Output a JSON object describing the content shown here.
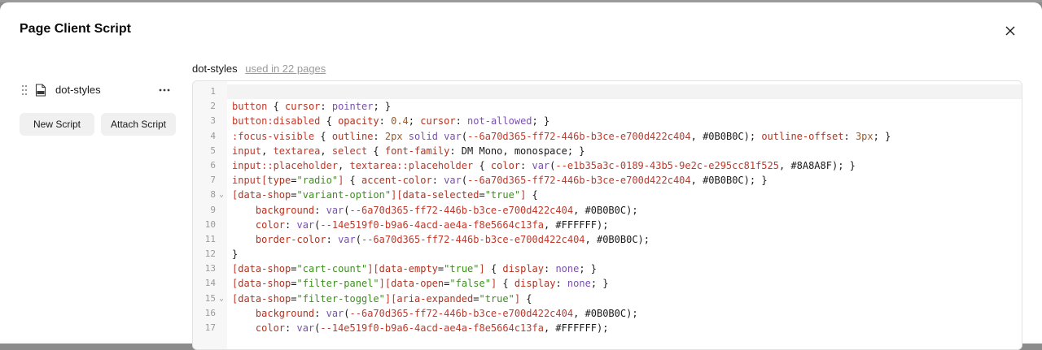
{
  "modal": {
    "title": "Page Client Script"
  },
  "sidebar": {
    "scripts": [
      {
        "name": "dot-styles",
        "icon": "css-file-icon"
      }
    ],
    "new_button": "New Script",
    "attach_button": "Attach Script"
  },
  "editor": {
    "script_name": "dot-styles",
    "usage": "used in 22 pages",
    "lines": [
      {
        "n": "1",
        "fold": false,
        "segments": []
      },
      {
        "n": "2",
        "fold": false,
        "segments": [
          {
            "t": "button",
            "c": "sel"
          },
          {
            "t": " { ",
            "c": "punc"
          },
          {
            "t": "cursor",
            "c": "prop"
          },
          {
            "t": ": ",
            "c": "punc"
          },
          {
            "t": "pointer",
            "c": "val"
          },
          {
            "t": "; }",
            "c": "punc"
          }
        ]
      },
      {
        "n": "3",
        "fold": false,
        "segments": [
          {
            "t": "button:disabled",
            "c": "sel"
          },
          {
            "t": " { ",
            "c": "punc"
          },
          {
            "t": "opacity",
            "c": "prop"
          },
          {
            "t": ": ",
            "c": "punc"
          },
          {
            "t": "0.4",
            "c": "num"
          },
          {
            "t": "; ",
            "c": "punc"
          },
          {
            "t": "cursor",
            "c": "prop"
          },
          {
            "t": ": ",
            "c": "punc"
          },
          {
            "t": "not-allowed",
            "c": "val"
          },
          {
            "t": "; }",
            "c": "punc"
          }
        ]
      },
      {
        "n": "4",
        "fold": false,
        "segments": [
          {
            "t": ":focus-visible",
            "c": "sel"
          },
          {
            "t": " { ",
            "c": "punc"
          },
          {
            "t": "outline",
            "c": "prop"
          },
          {
            "t": ": ",
            "c": "punc"
          },
          {
            "t": "2px",
            "c": "num"
          },
          {
            "t": " ",
            "c": "punc"
          },
          {
            "t": "solid",
            "c": "val"
          },
          {
            "t": " ",
            "c": "punc"
          },
          {
            "t": "var",
            "c": "func"
          },
          {
            "t": "(",
            "c": "punc"
          },
          {
            "t": "--6a70d365-ff72-446b-b3ce-e700d422c404",
            "c": "var"
          },
          {
            "t": ", #0B0B0C); ",
            "c": "punc"
          },
          {
            "t": "outline-offset",
            "c": "prop"
          },
          {
            "t": ": ",
            "c": "punc"
          },
          {
            "t": "3px",
            "c": "num"
          },
          {
            "t": "; }",
            "c": "punc"
          }
        ]
      },
      {
        "n": "5",
        "fold": false,
        "segments": [
          {
            "t": "input",
            "c": "sel"
          },
          {
            "t": ", ",
            "c": "punc"
          },
          {
            "t": "textarea",
            "c": "sel"
          },
          {
            "t": ", ",
            "c": "punc"
          },
          {
            "t": "select",
            "c": "sel"
          },
          {
            "t": " { ",
            "c": "punc"
          },
          {
            "t": "font-family",
            "c": "prop"
          },
          {
            "t": ": DM Mono, monospace; }",
            "c": "punc"
          }
        ]
      },
      {
        "n": "6",
        "fold": false,
        "segments": [
          {
            "t": "input::placeholder",
            "c": "sel"
          },
          {
            "t": ", ",
            "c": "punc"
          },
          {
            "t": "textarea::placeholder",
            "c": "sel"
          },
          {
            "t": " { ",
            "c": "punc"
          },
          {
            "t": "color",
            "c": "prop"
          },
          {
            "t": ": ",
            "c": "punc"
          },
          {
            "t": "var",
            "c": "func"
          },
          {
            "t": "(",
            "c": "punc"
          },
          {
            "t": "--e1b35a3c-0189-43b5-9e2c-e295cc81f525",
            "c": "var"
          },
          {
            "t": ", #8A8A8F); }",
            "c": "punc"
          }
        ]
      },
      {
        "n": "7",
        "fold": false,
        "segments": [
          {
            "t": "input[",
            "c": "sel"
          },
          {
            "t": "type",
            "c": "prop"
          },
          {
            "t": "=",
            "c": "punc"
          },
          {
            "t": "\"radio\"",
            "c": "str"
          },
          {
            "t": "]",
            "c": "sel"
          },
          {
            "t": " { ",
            "c": "punc"
          },
          {
            "t": "accent-color",
            "c": "prop"
          },
          {
            "t": ": ",
            "c": "punc"
          },
          {
            "t": "var",
            "c": "func"
          },
          {
            "t": "(",
            "c": "punc"
          },
          {
            "t": "--6a70d365-ff72-446b-b3ce-e700d422c404",
            "c": "var"
          },
          {
            "t": ", #0B0B0C); }",
            "c": "punc"
          }
        ]
      },
      {
        "n": "8",
        "fold": true,
        "segments": [
          {
            "t": "[",
            "c": "sel"
          },
          {
            "t": "data-shop",
            "c": "prop"
          },
          {
            "t": "=",
            "c": "punc"
          },
          {
            "t": "\"variant-option\"",
            "c": "str"
          },
          {
            "t": "][",
            "c": "sel"
          },
          {
            "t": "data-selected",
            "c": "prop"
          },
          {
            "t": "=",
            "c": "punc"
          },
          {
            "t": "\"true\"",
            "c": "str"
          },
          {
            "t": "]",
            "c": "sel"
          },
          {
            "t": " {",
            "c": "punc"
          }
        ]
      },
      {
        "n": "9",
        "fold": false,
        "segments": [
          {
            "t": "    ",
            "c": "punc"
          },
          {
            "t": "background",
            "c": "prop"
          },
          {
            "t": ": ",
            "c": "punc"
          },
          {
            "t": "var",
            "c": "func"
          },
          {
            "t": "(",
            "c": "punc"
          },
          {
            "t": "--6a70d365-ff72-446b-b3ce-e700d422c404",
            "c": "var"
          },
          {
            "t": ", #0B0B0C);",
            "c": "punc"
          }
        ]
      },
      {
        "n": "10",
        "fold": false,
        "segments": [
          {
            "t": "    ",
            "c": "punc"
          },
          {
            "t": "color",
            "c": "prop"
          },
          {
            "t": ": ",
            "c": "punc"
          },
          {
            "t": "var",
            "c": "func"
          },
          {
            "t": "(",
            "c": "punc"
          },
          {
            "t": "--14e519f0-b9a6-4acd-ae4a-f8e5664c13fa",
            "c": "var"
          },
          {
            "t": ", #FFFFFF);",
            "c": "punc"
          }
        ]
      },
      {
        "n": "11",
        "fold": false,
        "segments": [
          {
            "t": "    ",
            "c": "punc"
          },
          {
            "t": "border-color",
            "c": "prop"
          },
          {
            "t": ": ",
            "c": "punc"
          },
          {
            "t": "var",
            "c": "func"
          },
          {
            "t": "(",
            "c": "punc"
          },
          {
            "t": "--6a70d365-ff72-446b-b3ce-e700d422c404",
            "c": "var"
          },
          {
            "t": ", #0B0B0C);",
            "c": "punc"
          }
        ]
      },
      {
        "n": "12",
        "fold": false,
        "segments": [
          {
            "t": "}",
            "c": "punc"
          }
        ]
      },
      {
        "n": "13",
        "fold": false,
        "segments": [
          {
            "t": "[",
            "c": "sel"
          },
          {
            "t": "data-shop",
            "c": "prop"
          },
          {
            "t": "=",
            "c": "punc"
          },
          {
            "t": "\"cart-count\"",
            "c": "str"
          },
          {
            "t": "][",
            "c": "sel"
          },
          {
            "t": "data-empty",
            "c": "prop"
          },
          {
            "t": "=",
            "c": "punc"
          },
          {
            "t": "\"true\"",
            "c": "str"
          },
          {
            "t": "]",
            "c": "sel"
          },
          {
            "t": " { ",
            "c": "punc"
          },
          {
            "t": "display",
            "c": "prop"
          },
          {
            "t": ": ",
            "c": "punc"
          },
          {
            "t": "none",
            "c": "val"
          },
          {
            "t": "; }",
            "c": "punc"
          }
        ]
      },
      {
        "n": "14",
        "fold": false,
        "segments": [
          {
            "t": "[",
            "c": "sel"
          },
          {
            "t": "data-shop",
            "c": "prop"
          },
          {
            "t": "=",
            "c": "punc"
          },
          {
            "t": "\"filter-panel\"",
            "c": "str"
          },
          {
            "t": "][",
            "c": "sel"
          },
          {
            "t": "data-open",
            "c": "prop"
          },
          {
            "t": "=",
            "c": "punc"
          },
          {
            "t": "\"false\"",
            "c": "str"
          },
          {
            "t": "]",
            "c": "sel"
          },
          {
            "t": " { ",
            "c": "punc"
          },
          {
            "t": "display",
            "c": "prop"
          },
          {
            "t": ": ",
            "c": "punc"
          },
          {
            "t": "none",
            "c": "val"
          },
          {
            "t": "; }",
            "c": "punc"
          }
        ]
      },
      {
        "n": "15",
        "fold": true,
        "segments": [
          {
            "t": "[",
            "c": "sel"
          },
          {
            "t": "data-shop",
            "c": "prop"
          },
          {
            "t": "=",
            "c": "punc"
          },
          {
            "t": "\"filter-toggle\"",
            "c": "str"
          },
          {
            "t": "][",
            "c": "sel"
          },
          {
            "t": "aria-expanded",
            "c": "prop"
          },
          {
            "t": "=",
            "c": "punc"
          },
          {
            "t": "\"true\"",
            "c": "str"
          },
          {
            "t": "]",
            "c": "sel"
          },
          {
            "t": " {",
            "c": "punc"
          }
        ]
      },
      {
        "n": "16",
        "fold": false,
        "segments": [
          {
            "t": "    ",
            "c": "punc"
          },
          {
            "t": "background",
            "c": "prop"
          },
          {
            "t": ": ",
            "c": "punc"
          },
          {
            "t": "var",
            "c": "func"
          },
          {
            "t": "(",
            "c": "punc"
          },
          {
            "t": "--6a70d365-ff72-446b-b3ce-e700d422c404",
            "c": "var"
          },
          {
            "t": ", #0B0B0C);",
            "c": "punc"
          }
        ]
      },
      {
        "n": "17",
        "fold": false,
        "segments": [
          {
            "t": "    ",
            "c": "punc"
          },
          {
            "t": "color",
            "c": "prop"
          },
          {
            "t": ": ",
            "c": "punc"
          },
          {
            "t": "var",
            "c": "func"
          },
          {
            "t": "(",
            "c": "punc"
          },
          {
            "t": "--14e519f0-b9a6-4acd-ae4a-f8e5664c13fa",
            "c": "var"
          },
          {
            "t": ", #FFFFFF);",
            "c": "punc"
          }
        ]
      }
    ]
  }
}
